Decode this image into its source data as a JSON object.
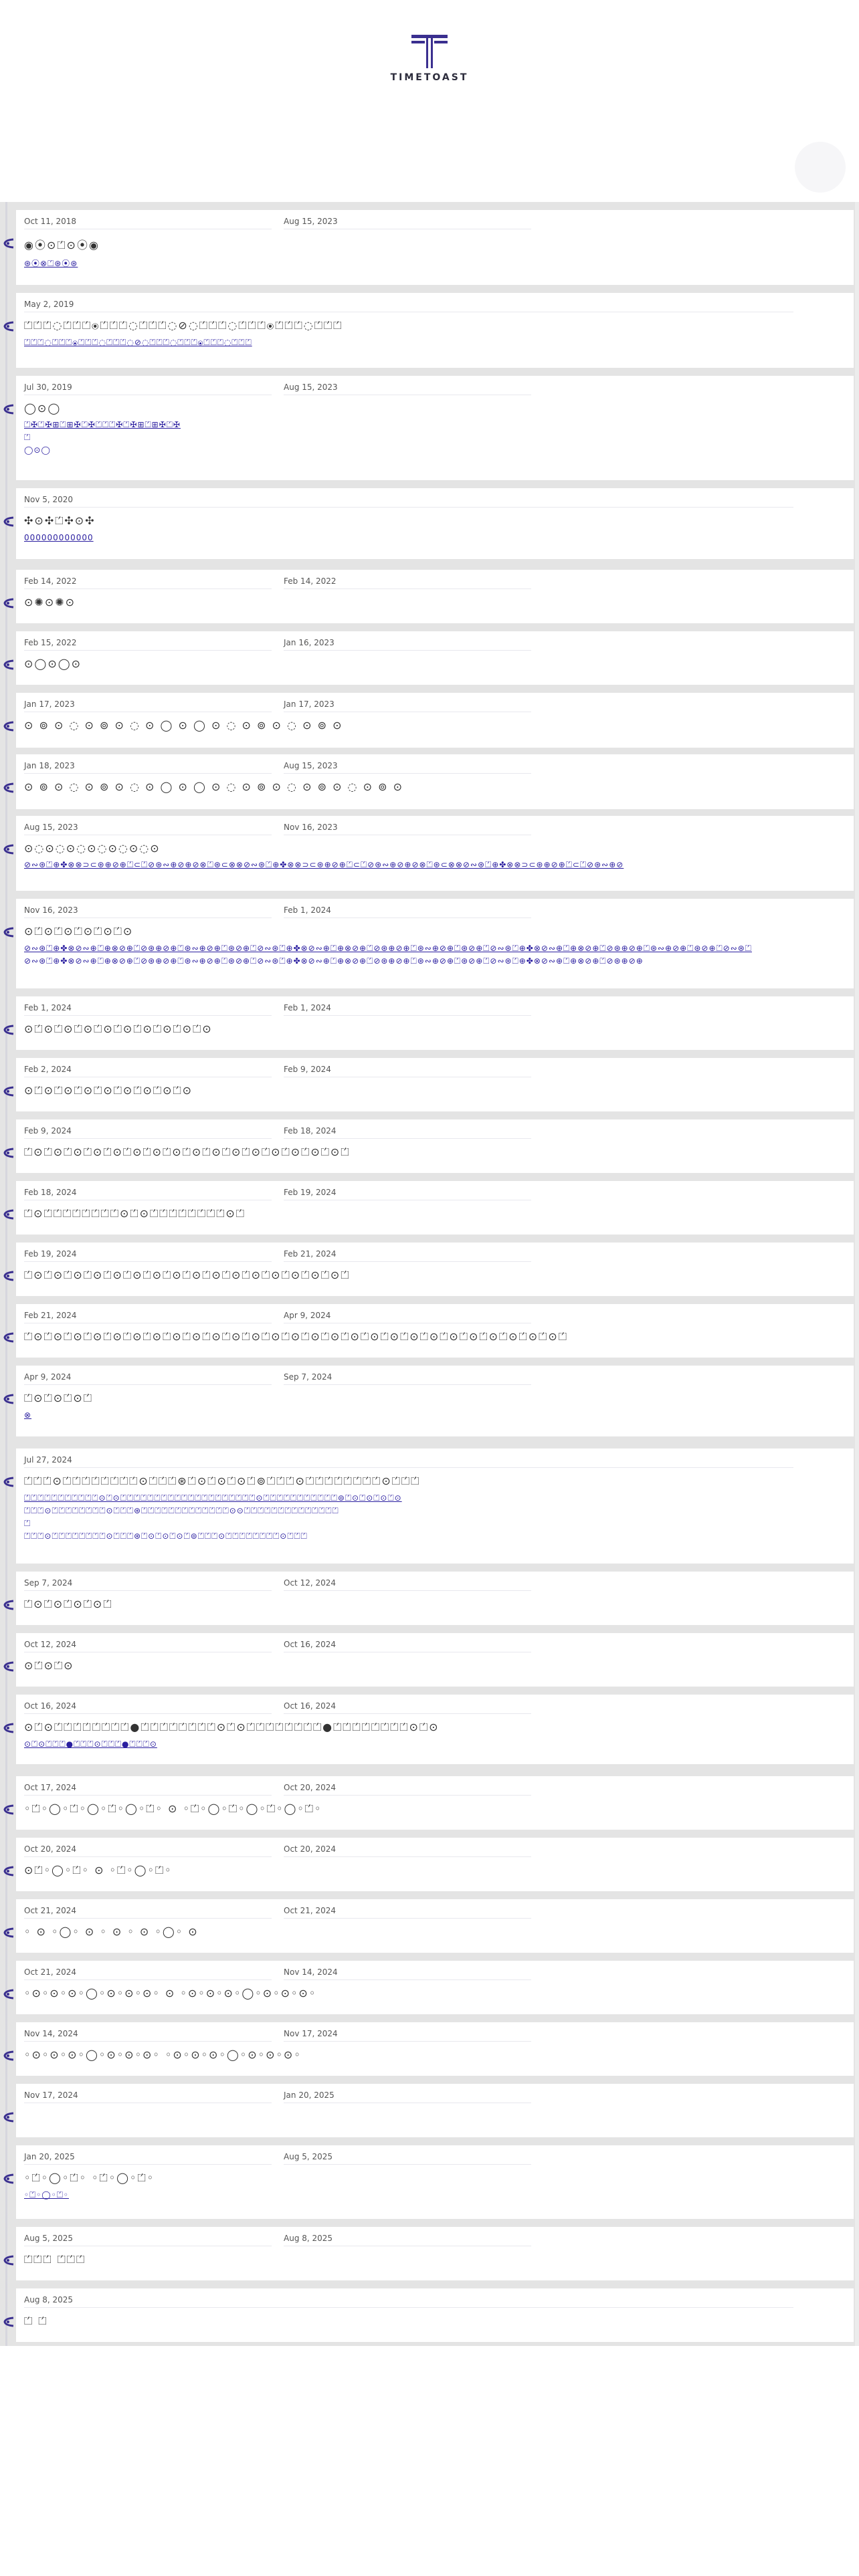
{
  "brand": {
    "logo_text": "TIMETOAST",
    "accent": "#3a2f8f",
    "link_color": "#2b1fa0"
  },
  "entries": [
    {
      "start": "Oct 11, 2018",
      "end": "Aug 15, 2023",
      "title": "◉⦿⊙⏍⊙⦿◉",
      "link": "⊛⦿⊗⏍⊛⦿⊛"
    },
    {
      "start": "May 2, 2019",
      "end": "",
      "title": "⏍⏍⏍◌⏍⏍⏍⦿⏍⏍⏍◌⏍⏍⏍◌⊘◌⏍⏍⏍◌⏍⏍⏍⦿⏍⏍⏍◌⏍⏍⏍",
      "link": "⏍⏍⏍◌⏍⏍⏍⦿⏍⏍⏍◌⏍⏍⏍◌⊘◌⏍⏍⏍◌⏍⏍⏍⦿⏍⏍⏍◌⏍⏍⏍"
    },
    {
      "start": "Jul 30, 2019",
      "end": "Aug 15, 2023",
      "title": "◯⊙◯",
      "link": "⏍✠⏍✠⊞⏍⊞✠⏍✠⏍⏍⏍✠⏍✠⊞⏍⊞✠⏍✠",
      "sub1": "⏍",
      "sub2": "◯⊙◯"
    },
    {
      "start": "Nov 5, 2020",
      "end": "",
      "title": "✣⊙✣⏍✣⊙✣",
      "link": "000000000000"
    },
    {
      "start": "Feb 14, 2022",
      "end": "Feb 14, 2022",
      "title": "⊙✺⊙✺⊙",
      "link": ""
    },
    {
      "start": "Feb 15, 2022",
      "end": "Jan 16, 2023",
      "title": "⊙◯⊙◯⊙",
      "link": ""
    },
    {
      "start": "Jan 17, 2023",
      "end": "Jan 17, 2023",
      "title": "⊙ ⊚ ⊙ ◌ ⊙ ⊚ ⊙ ◌ ⊙ ◯ ⊙ ◯ ⊙ ◌ ⊙ ⊚ ⊙ ◌ ⊙ ⊚ ⊙",
      "link": ""
    },
    {
      "start": "Jan 18, 2023",
      "end": "Aug 15, 2023",
      "title": "⊙ ⊚ ⊙ ◌ ⊙ ⊚ ⊙ ◌ ⊙ ◯ ⊙ ◯ ⊙ ◌ ⊙ ⊚ ⊙ ◌ ⊙ ⊚ ⊙ ◌ ⊙ ⊚ ⊙",
      "link": ""
    },
    {
      "start": "Aug 15, 2023",
      "end": "Nov 16, 2023",
      "title": "⊙◌⊙◌⊙◌⊙◌⊙◌⊙◌⊙",
      "link": "⊘∾⊛⏍⊕✤⊗⊗⊃⊂⊛⊕⊘⊕⏍⊂⏍⊘⊛∾⊕⊘⊕⊘⊗⏍⊛⊂⊗⊗⊘∾⊛⏍⊕✤⊗⊗⊃⊂⊛⊕⊘⊕⏍⊂⏍⊘⊛∾⊕⊘⊕⊘⊗⏍⊛⊂⊗⊗⊘∾⊛⏍⊕✤⊗⊗⊃⊂⊛⊕⊘⊕⏍⊂⏍⊘⊛∾⊕⊘"
    },
    {
      "start": "Nov 16, 2023",
      "end": "Feb 1, 2024",
      "title": "⊙⏍⊙⏍⊙⏍⊙⏍⊙⏍⊙",
      "link": "⊘∾⊛⏍⊕✤⊗⊘∾⊕⏍⊕⊗⊘⊕⏍⊘⊛⊕⊘⊕⏍⊛∾⊕⊘⊕⏍⊛⊘⊕⏍⊘∾⊛⏍⊕✤⊗⊘∾⊕⏍⊕⊗⊘⊕⏍⊘⊛⊕⊘⊕⏍⊛∾⊕⊘⊕⏍⊛⊘⊕⏍⊘∾⊛⏍⊕✤⊗⊘∾⊕⏍⊕⊗⊘⊕⏍⊘⊛⊕⊘⊕⏍⊛∾⊕⊘⊕⏍⊛⊘⊕⏍⊘∾⊛⏍",
      "sub1": "⊘∾⊛⏍⊕✤⊗⊘∾⊕⏍⊕⊗⊘⊕⏍⊘⊛⊕⊘⊕⏍⊛∾⊕⊘⊕⏍⊛⊘⊕⏍⊘∾⊛⏍⊕✤⊗⊘∾⊕⏍⊕⊗⊘⊕⏍⊘⊛⊕⊘⊕⏍⊛∾⊕⊘⊕⏍⊛⊘⊕⏍⊘∾⊛⏍⊕✤⊗⊘∾⊕⏍⊕⊗⊘⊕⏍⊘⊛⊕⊘⊕"
    },
    {
      "start": "Feb 1, 2024",
      "end": "Feb 1, 2024",
      "title": "⊙⏍⊙⏍⊙⏍⊙⏍⊙⏍⊙⏍⊙⏍⊙⏍⊙⏍⊙",
      "link": ""
    },
    {
      "start": "Feb 2, 2024",
      "end": "Feb 9, 2024",
      "title": "⊙⏍⊙⏍⊙⏍⊙⏍⊙⏍⊙⏍⊙⏍⊙⏍⊙",
      "link": ""
    },
    {
      "start": "Feb 9, 2024",
      "end": "Feb 18, 2024",
      "title": "⏍⊙⏍⊙⏍⊙⏍⊙⏍⊙⏍⊙⏍⊙⏍⊙⏍⊙⏍⊙⏍⊙⏍⊙⏍⊙⏍⊙⏍⊙⏍⊙⏍",
      "link": ""
    },
    {
      "start": "Feb 18, 2024",
      "end": "Feb 19, 2024",
      "title": "⏍⊙⏍⏍⏍⏍⏍⏍⏍⏍⊙⏍⊙⏍⏍⏍⏍⏍⏍⏍⏍⊙⏍",
      "link": ""
    },
    {
      "start": "Feb 19, 2024",
      "end": "Feb 21, 2024",
      "title": "⏍⊙⏍⊙⏍⊙⏍⊙⏍⊙⏍⊙⏍⊙⏍⊙⏍⊙⏍⊙⏍⊙⏍⊙⏍⊙⏍⊙⏍⊙⏍⊙⏍",
      "link": ""
    },
    {
      "start": "Feb 21, 2024",
      "end": "Apr 9, 2024",
      "title": "⏍⊙⏍⊙⏍⊙⏍⊙⏍⊙⏍⊙⏍⊙⏍⊙⏍⊙⏍⊙⏍⊙⏍⊙⏍⊙⏍⊙⏍⊙⏍⊙⏍⊙⏍⊙⏍⊙⏍⊙⏍⊙⏍⊙⏍⊙⏍⊙⏍⊙⏍⊙⏍⊙⏍",
      "link": ""
    },
    {
      "start": "Apr 9, 2024",
      "end": "Sep 7, 2024",
      "title": "⏍⊙⏍⊙⏍⊙⏍",
      "link": "⊗"
    },
    {
      "start": "Jul 27, 2024",
      "end": "",
      "title": "⏍⏍⏍⊙⏍⏍⏍⏍⏍⏍⏍⏍⊙⏍⏍⏍⊛⏍⊙⏍⊙⏍⊙⏍⊚⏍⏍⏍⊙⏍⏍⏍⏍⏍⏍⏍⏍⊙⏍⏍⏍",
      "link": "⏍⏍⏍⏍⏍⏍⏍⏍⏍⏍⏍⊙⏍⊙⏍⏍⏍⏍⏍⏍⏍⏍⏍⏍⏍⏍⏍⏍⏍⏍⏍⏍⏍⏍⊙⏍⏍⏍⏍⏍⏍⏍⏍⏍⏍⏍⊚⏍⊙⏍⊙⏍⊙⏍⊙",
      "sub1": "⏍⏍⏍⊙⏍⏍⏍⏍⏍⏍⏍⏍⊙⏍⏍⏍⊛⏍⏍⏍⏍⏍⏍⏍⏍⏍⏍⏍⏍⏍⊙⊙⏍⏍⏍⏍⏍⏍⏍⏍⏍⏍⏍⏍⏍⏍",
      "sub2": "⏍",
      "sub3": "⏍⏍⏍⊙⏍⏍⏍⏍⏍⏍⏍⏍⊙⏍⏍⏍⊛⏍⊙⏍⊙⏍⊙⏍⊚⏍⏍⏍⊙⏍⏍⏍⏍⏍⏍⏍⏍⊙⏍⏍⏍"
    },
    {
      "start": "Sep 7, 2024",
      "end": "Oct 12, 2024",
      "title": "⏍⊙⏍⊙⏍⊙⏍⊙⏍",
      "link": ""
    },
    {
      "start": "Oct 12, 2024",
      "end": "Oct 16, 2024",
      "title": "⊙⏍⊙⏍⊙",
      "link": ""
    },
    {
      "start": "Oct 16, 2024",
      "end": "Oct 16, 2024",
      "title": "⊙⏍⊙⏍⏍⏍⏍⏍⏍⏍⏍●⏍⏍⏍⏍⏍⏍⏍⏍⊙⏍⊙⏍⏍⏍⏍⏍⏍⏍⏍●⏍⏍⏍⏍⏍⏍⏍⏍⊙⏍⊙",
      "link": "⊙⏍⊙⏍⏍⏍●⏍⏍⏍⊙⏍⏍⏍●⏍⏍⏍⊙"
    },
    {
      "start": "Oct 17, 2024",
      "end": "Oct 20, 2024",
      "title": "◦⏍◦◯◦⏍◦◯◦⏍◦◯◦⏍◦          ⊙          ◦⏍◦◯◦⏍◦◯◦⏍◦◯◦⏍◦",
      "link": ""
    },
    {
      "start": "Oct 20, 2024",
      "end": "Oct 20, 2024",
      "title": "⊙⏍◦◯◦⏍◦    ⊙    ◦⏍◦◯◦⏍◦",
      "link": ""
    },
    {
      "start": "Oct 21, 2024",
      "end": "Oct 21, 2024",
      "title": "◦ ⊙ ◦◯◦ ⊙ ◦     ⊙     ◦ ⊙ ◦◯◦ ⊙",
      "link": ""
    },
    {
      "start": "Oct 21, 2024",
      "end": "Nov 14, 2024",
      "title": "◦⊙◦⊙◦⊙◦◯◦⊙◦⊙◦⊙◦              ⊙              ◦⊙◦⊙◦⊙◦◯◦⊙◦⊙◦⊙◦",
      "link": ""
    },
    {
      "start": "Nov 14, 2024",
      "end": "Nov 17, 2024",
      "title": "◦⊙◦⊙◦⊙◦◯◦⊙◦⊙◦⊙◦                    ◦⊙◦⊙◦⊙◦◯◦⊙◦⊙◦⊙◦",
      "link": ""
    },
    {
      "start": "Nov 17, 2024",
      "end": "Jan 20, 2025",
      "title": "",
      "link": ""
    },
    {
      "start": "Jan 20, 2025",
      "end": "Aug 5, 2025",
      "title": "◦⏍◦◯◦⏍◦            ◦⏍◦◯◦⏍◦",
      "link": "◦⏍◦◯◦⏍◦"
    },
    {
      "start": "Aug 5, 2025",
      "end": "Aug 8, 2025",
      "title": "⏍⏍⏍   ⏍⏍⏍",
      "link": ""
    },
    {
      "start": "Aug 8, 2025",
      "end": "",
      "title": "⏍   ⏍",
      "link": ""
    }
  ]
}
